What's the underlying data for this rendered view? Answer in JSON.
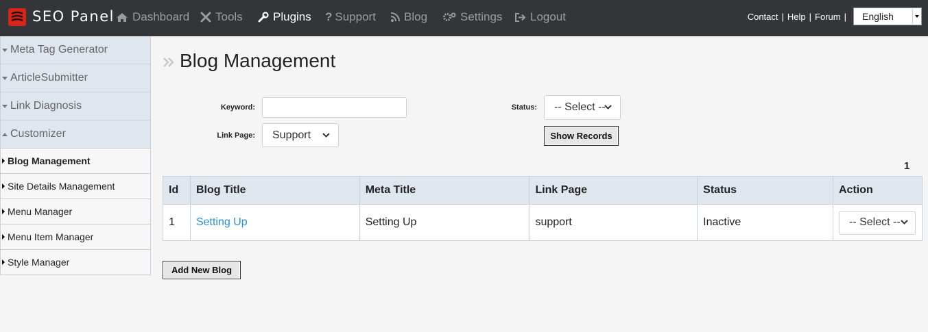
{
  "app": {
    "brand": "SEO Panel"
  },
  "nav": {
    "items": [
      {
        "label": "Dashboard",
        "icon": "home-icon"
      },
      {
        "label": "Tools",
        "icon": "tools-icon"
      },
      {
        "label": "Plugins",
        "icon": "wrench-icon",
        "active": true
      },
      {
        "label": "Support",
        "icon": "question-icon"
      },
      {
        "label": "Blog",
        "icon": "rss-icon"
      },
      {
        "label": "Settings",
        "icon": "gears-icon"
      },
      {
        "label": "Logout",
        "icon": "logout-icon"
      }
    ],
    "links": [
      "Contact",
      "Help",
      "Forum"
    ],
    "language": "English"
  },
  "sidebar": {
    "sections": [
      "Meta Tag Generator",
      "ArticleSubmitter",
      "Link Diagnosis",
      "Customizer"
    ],
    "items": [
      "Blog Management",
      "Site Details Management",
      "Menu Manager",
      "Menu Item Manager",
      "Style Manager"
    ]
  },
  "main": {
    "title": "Blog Management",
    "filters": {
      "keyword_label": "Keyword:",
      "keyword_value": "",
      "status_label": "Status:",
      "status_value": "-- Select --",
      "linkpage_label": "Link Page:",
      "linkpage_value": "Support",
      "show_button": "Show Records"
    },
    "page_number": "1",
    "table": {
      "headers": [
        "Id",
        "Blog Title",
        "Meta Title",
        "Link Page",
        "Status",
        "Action"
      ],
      "rows": [
        {
          "id": "1",
          "blog_title": "Setting Up",
          "meta_title": "Setting Up",
          "link_page": "support",
          "status": "Inactive",
          "action": "-- Select --"
        }
      ]
    },
    "add_button": "Add New Blog"
  },
  "colors": {
    "navbar": "#333539",
    "accent": "#d9241c",
    "link": "#2a8fd6",
    "header_bg": "#dfe6ee"
  }
}
